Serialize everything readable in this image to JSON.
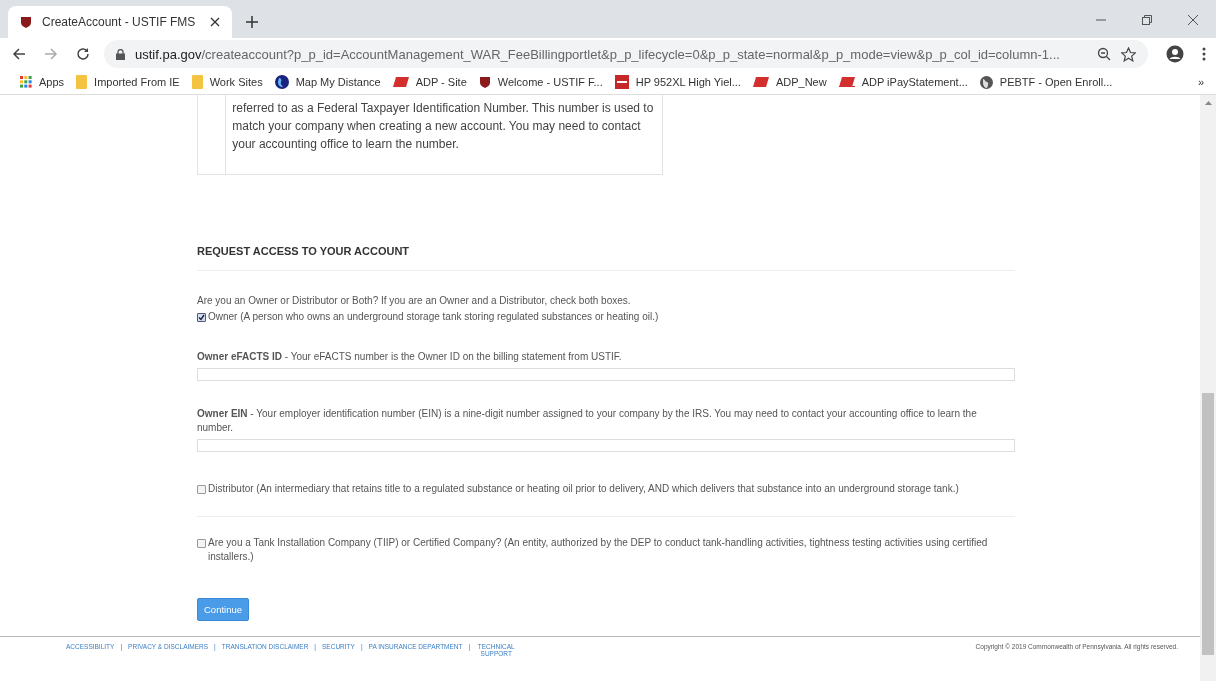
{
  "browser": {
    "tab": {
      "title": "CreateAccount - USTIF FMS",
      "selected": true
    },
    "url_host": "ustif.pa.gov",
    "url_path": "/createaccount?p_p_id=AccountManagement_WAR_FeeBillingportlet&p_p_lifecycle=0&p_p_state=normal&p_p_mode=view&p_p_col_id=column-1...",
    "bookmarks": [
      {
        "label": "Apps",
        "kind": "apps"
      },
      {
        "label": "Imported From IE",
        "kind": "folder"
      },
      {
        "label": "Work Sites",
        "kind": "folder"
      },
      {
        "label": "Map My Distance",
        "kind": "globe"
      },
      {
        "label": "ADP - Site",
        "kind": "adp"
      },
      {
        "label": "Welcome - USTIF F...",
        "kind": "pa"
      },
      {
        "label": "HP 952XL High Yiel...",
        "kind": "store"
      },
      {
        "label": "ADP_New",
        "kind": "adp"
      },
      {
        "label": "ADP iPayStatement...",
        "kind": "adp-box"
      },
      {
        "label": "PEBTF - Open Enroll...",
        "kind": "world"
      }
    ],
    "more": "»"
  },
  "info_box": {
    "text": "referred to as a Federal Taxpayer Identification Number. This number is used to match your company when creating a new account. You may need to contact your accounting office to learn the number."
  },
  "section": {
    "heading": "REQUEST ACCESS TO YOUR ACCOUNT",
    "intro": "Are you an Owner or Distributor or Both? If you are an Owner and a Distributor, check both boxes.",
    "items": [
      {
        "kind": "checkbox",
        "label": "Owner (A person who owns an underground storage tank storing regulated substances or heating oil.)",
        "checked": true
      },
      {
        "kind": "field",
        "label": "**Owner eFACTS ID** - Your eFACTS number is the Owner ID on the billing statement from USTIF."
      },
      {
        "kind": "field",
        "label": "**Owner EIN** - Your employer identification number (EIN) is a nine-digit number assigned to your company by the IRS. You may need to contact your accounting office to learn the number."
      },
      {
        "kind": "checkbox",
        "label": "Distributor (An intermediary that retains title to a regulated substance or heating oil prior to delivery, AND which delivers that substance into an underground storage tank.)",
        "checked": false
      },
      {
        "kind": "separator"
      },
      {
        "kind": "checkbox",
        "label": "Are you a Tank Installation Company (TIIP) or Certified Company? (An entity, authorized by the DEP to conduct tank-handling activities, tightness testing activities using certified installers.)",
        "checked": false
      }
    ],
    "button": "Continue"
  },
  "footer": {
    "links": [
      "ACCESSIBILITY",
      "PRIVACY & DISCLAIMERS",
      "TRANSLATION DISCLAIMER",
      "SECURITY",
      "PA INSURANCE DEPARTMENT",
      "TECHNICAL SUPPORT"
    ],
    "separator": "|",
    "copyright": "Copyright © 2019 Commonwealth of Pennsylvania. All rights reserved."
  }
}
